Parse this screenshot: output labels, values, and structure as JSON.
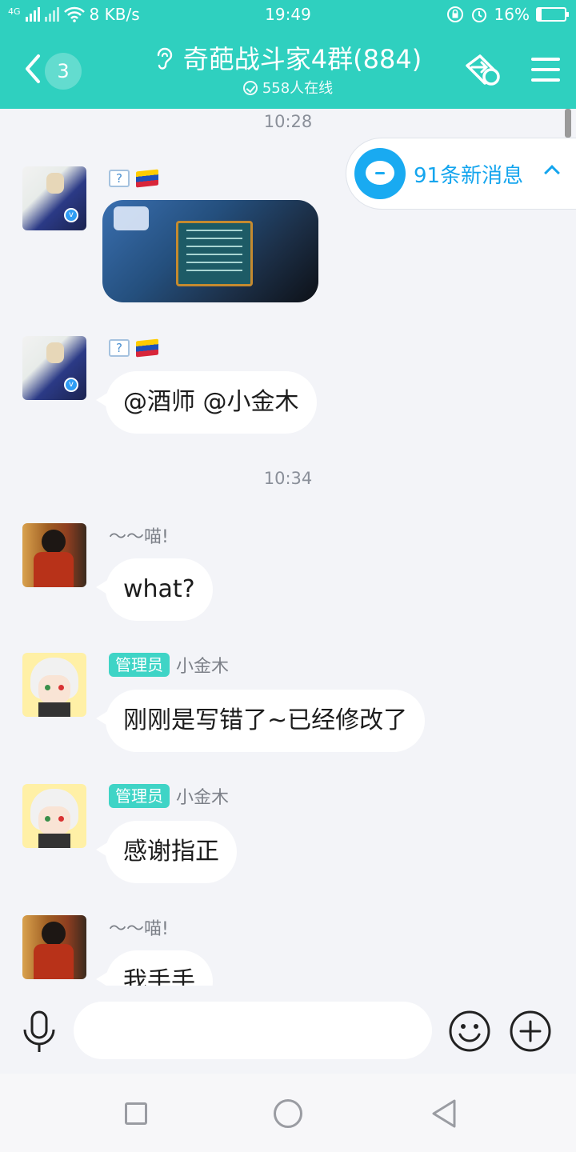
{
  "status_bar": {
    "network_label": "4G",
    "speed": "8 KB/s",
    "time": "19:49",
    "battery": "16%",
    "battery_level": 0.16
  },
  "header": {
    "unread_count": "3",
    "title": "奇葩战斗家4群(884)",
    "online_text": "558人在线"
  },
  "new_messages_label": "91条新消息",
  "messages": [
    {
      "type": "time",
      "text": "10:28"
    },
    {
      "type": "image",
      "sender_flag": "venezuela-flag",
      "image_desc": "game-screenshot"
    },
    {
      "type": "text",
      "text": "@酒师 @小金木"
    },
    {
      "type": "time",
      "text": "10:34"
    },
    {
      "type": "text",
      "sender": "～～喵!",
      "text": "what?"
    },
    {
      "type": "text",
      "role": "管理员",
      "sender": "小金木",
      "text": "刚刚是写错了~已经修改了"
    },
    {
      "type": "text",
      "role": "管理员",
      "sender": "小金木",
      "text": "感谢指正"
    },
    {
      "type": "text",
      "sender": "～～喵!",
      "text": "我手手"
    }
  ],
  "colors": {
    "header_bg": "#2fd0bf",
    "accent_blue": "#14a5ee",
    "role_badge": "#3fd4c6",
    "chat_bg": "#f3f4f8"
  },
  "icons": [
    "back-icon",
    "hearing-icon",
    "share-icon",
    "menu-icon",
    "mic-icon",
    "emoji-icon",
    "plus-icon"
  ]
}
